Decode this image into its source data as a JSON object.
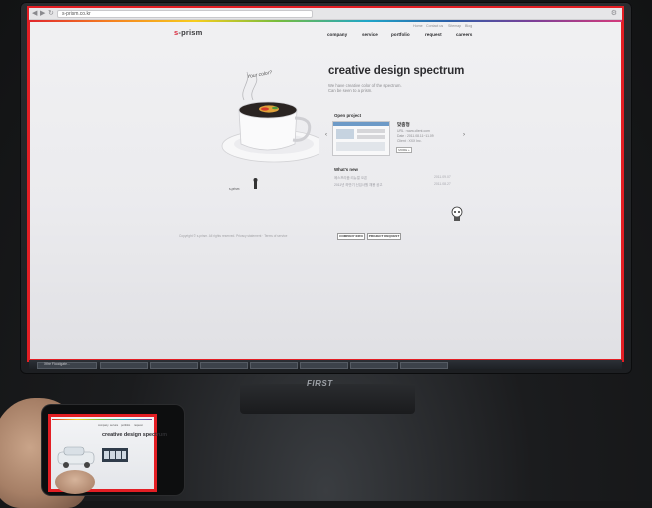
{
  "browser": {
    "back_icon": "back-arrow-icon",
    "forward_icon": "forward-arrow-icon",
    "reload_icon": "reload-icon",
    "url": "s-prism.co.kr",
    "menu_icon": "wrench-icon"
  },
  "site": {
    "util_links": [
      "Home",
      "Contact us",
      "Sitemap",
      "Blog"
    ],
    "logo_mark": "s",
    "logo_text": "-prism",
    "nav": [
      "company",
      "service",
      "portfolio",
      "request",
      "careers"
    ],
    "illustration_text": "Your color?",
    "headline": "creative design spectrum",
    "subtitle_line1": "We have creative color of the spectrum.",
    "subtitle_line2": "Can be seen to a prism.",
    "open_project_label": "Open project",
    "prev_arrow": "‹",
    "next_arrow": "›",
    "project_title": "맞춤형",
    "project_meta": [
      "URL : www.client.com",
      "Date : 2011.08.11~11.09",
      "Client : XXX Inc."
    ],
    "project_more": "MORE +",
    "whats_new_label": "What's new",
    "news": [
      {
        "title": "에스프리즘 리뉴얼 오픈",
        "date": "2011.09.07"
      },
      {
        "title": "2011년 하반기 신입사원 채용 공고",
        "date": "2011.08.27"
      }
    ],
    "footer_text": "Copyright © s-prism. All rights reserved. Privacy statement · Terms of service",
    "footer_buttons": [
      "COMPANY INFO",
      "PROJECT REQUEST"
    ],
    "tray_label": "s-prism"
  },
  "taskbar": {
    "items": [
      "Xfire Floodgate...",
      "",
      "",
      "",
      "",
      "",
      "",
      ""
    ]
  },
  "monitor_brand": "FIRST",
  "phone": {
    "headline": "creative design spectrum",
    "nav": [
      "company",
      "service",
      "portfolio",
      "request"
    ]
  },
  "colors": {
    "highlight": "#e31e24",
    "logo_dot": "#d9263a",
    "headline": "#2c2c2f"
  }
}
